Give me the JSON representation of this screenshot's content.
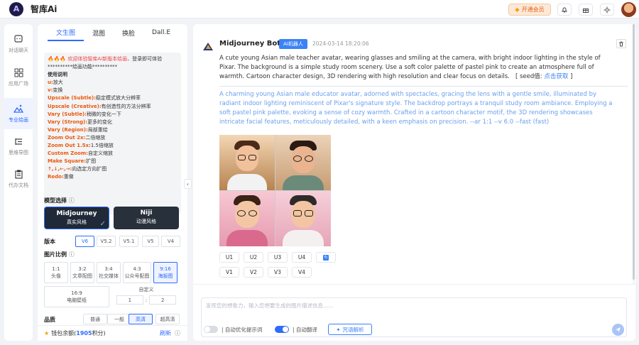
{
  "app": {
    "name": "智库Ai",
    "logo_letter": "A",
    "vip_label": "开通会员"
  },
  "topbar_icons": [
    "bell-icon",
    "gift-icon",
    "sun-icon"
  ],
  "nav": [
    {
      "label": "对话聊天",
      "icon": "chat-icon"
    },
    {
      "label": "应用广场",
      "icon": "grid-icon"
    },
    {
      "label": "专业绘画",
      "icon": "paint-icon",
      "active": true
    },
    {
      "label": "思维导图",
      "icon": "mindmap-icon"
    },
    {
      "label": "代办文档",
      "icon": "clipboard-icon"
    }
  ],
  "tabs": [
    "文生图",
    "混图",
    "换脸",
    "Dall.E"
  ],
  "notice": {
    "line1_emoji": "🔥🔥🔥",
    "line1_red": "欢迎体验智库Ai新版本绘画，",
    "line1_rest": "登录即可体验",
    "line2": "**********绘画功能**********",
    "heading": "使用说明",
    "rows": [
      {
        "k": "u:",
        "v": "放大"
      },
      {
        "k": "v:",
        "v": "变换"
      },
      {
        "k": "Upscale (Subtle):",
        "v": "稳定模式放大分辨率"
      },
      {
        "k": "Upscale (Creative):",
        "v": "有创造性的方法分辨率"
      },
      {
        "k": "Vary (Subtle):",
        "v": "稍微的变化一下"
      },
      {
        "k": "Vary (Strong):",
        "v": "更多的变化"
      },
      {
        "k": "Vary (Region):",
        "v": "局部重绘"
      },
      {
        "k": "Zoom Out 2x:",
        "v": "二倍缩放"
      },
      {
        "k": "Zoom Out 1.5x:",
        "v": "1.5倍缩放"
      },
      {
        "k": "Custom Zoom:",
        "v": "自定义缩放"
      },
      {
        "k": "Make Square:",
        "v": "扩图"
      },
      {
        "k": "↑,↓,←,→:",
        "v": "向选定方向扩图"
      },
      {
        "k": "Redo:",
        "v": "重做"
      }
    ]
  },
  "model": {
    "title": "模型选择",
    "cards": [
      {
        "name": "Midjourney",
        "sub": "真实风格",
        "selected": true
      },
      {
        "name": "Niji",
        "sub": "动漫风格"
      }
    ]
  },
  "version": {
    "title": "版本",
    "options": [
      "V6",
      "V5.2",
      "V5.1",
      "V5",
      "V4"
    ],
    "selected": "V6"
  },
  "ratio": {
    "title": "图片比例",
    "options": [
      {
        "r": "1:1",
        "n": "头像"
      },
      {
        "r": "3:2",
        "n": "文章配图"
      },
      {
        "r": "3:4",
        "n": "社交媒体"
      },
      {
        "r": "4:3",
        "n": "公众号配图"
      },
      {
        "r": "9:16",
        "n": "海报图",
        "selected": true
      }
    ],
    "wide": {
      "r": "16:9",
      "n": "电脑壁纸"
    },
    "custom": {
      "label": "自定义",
      "w": "1",
      "sep": ":",
      "h": "2"
    }
  },
  "quality": {
    "title": "品质",
    "options": [
      "普通",
      "一般",
      "高清",
      "超高清"
    ],
    "selected": "高清"
  },
  "balance": {
    "pre": "钱包余额(",
    "amount": "1905",
    "post": "积分)",
    "refresh": "刷新"
  },
  "message": {
    "sender": "Midjourney Bot",
    "badge": "AI机器人",
    "time": "2024-03-14 18:20:06",
    "prompt": "A cute young Asian male teacher avatar, wearing glasses and smiling at the camera, with bright indoor lighting in the style of Pixar. The background is a simple study room scenery. Use a soft color palette of pastel pink to create an atmosphere full of warmth. Cartoon character design, 3D rendering with high resolution and clear focus on details.",
    "seed_label": "[ seed值:",
    "seed_link": "点击获取",
    "seed_end": "]",
    "enhanced": "A charming young Asian male educator avatar, adorned with spectacles, gracing the lens with a gentle smile, illuminated by radiant indoor lighting reminiscent of Pixar's signature style. The backdrop portrays a tranquil study room ambiance. Employing a soft pastel pink palette, evoking a sense of cozy warmth. Crafted in a cartoon character motif, the 3D rendering showcases intricate facial features, meticulously detailed, with a keen emphasis on precision. --ar 1:1 --v 6.0 --fast  (fast)",
    "upscale": [
      "U1",
      "U2",
      "U3",
      "U4"
    ],
    "vary": [
      "V1",
      "V2",
      "V3",
      "V4"
    ]
  },
  "input": {
    "placeholder": "发挥您的想象力，输入您想要生成的图片描述信息......",
    "opt1": "自动优化提示词",
    "opt1_on": false,
    "opt2": "自动翻译",
    "opt2_on": true,
    "parse": "咒语解析"
  },
  "colors": {
    "accent": "#2f6bff",
    "orange": "#ea580c"
  }
}
